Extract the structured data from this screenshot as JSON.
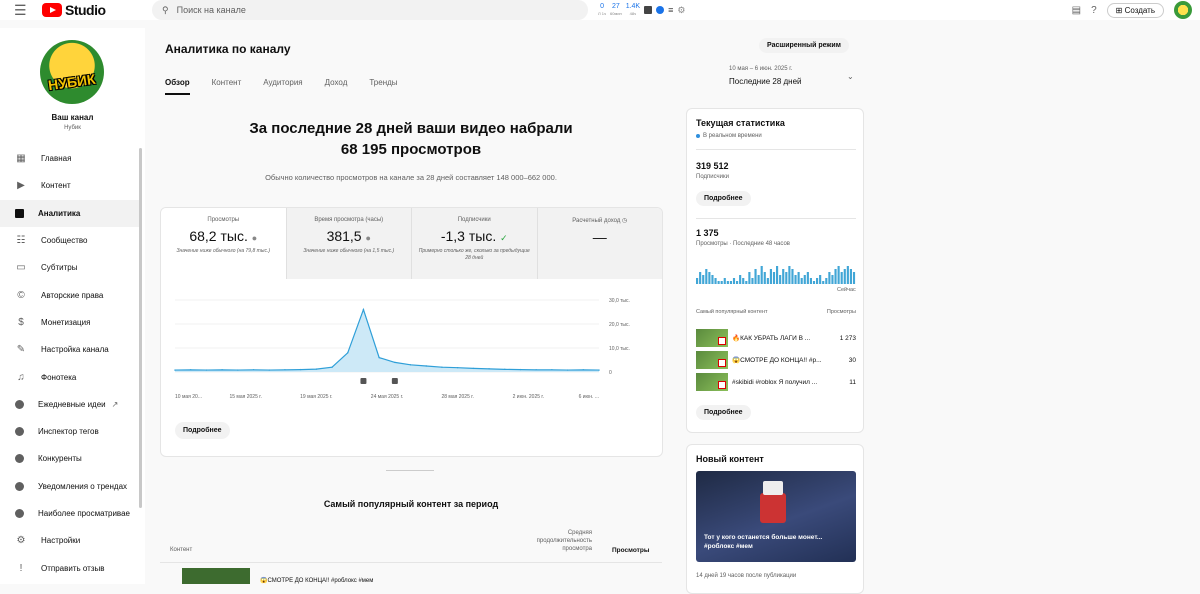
{
  "topbar": {
    "logo_text": "Studio",
    "search_placeholder": "Поиск на канале",
    "ext_stats": [
      {
        "value": "0",
        "sub": "Л 1ч"
      },
      {
        "value": "27",
        "sub": "60мин"
      },
      {
        "value": "1.4K",
        "sub": "48ч"
      }
    ],
    "create_label": "Создать"
  },
  "sidebar": {
    "your_channel": "Ваш канал",
    "channel_name": "Нубик",
    "avatar_text": "НУБИК",
    "items": [
      {
        "label": "Главная",
        "icon": "dashboard-icon"
      },
      {
        "label": "Контент",
        "icon": "content-icon"
      },
      {
        "label": "Аналитика",
        "icon": "analytics-icon"
      },
      {
        "label": "Сообщество",
        "icon": "community-icon"
      },
      {
        "label": "Субтитры",
        "icon": "subtitles-icon"
      },
      {
        "label": "Авторские права",
        "icon": "copyright-icon"
      },
      {
        "label": "Монетизация",
        "icon": "monetization-icon"
      },
      {
        "label": "Настройка канала",
        "icon": "customization-icon"
      },
      {
        "label": "Фонотека",
        "icon": "audio-library-icon"
      },
      {
        "label": "Ежедневные идеи",
        "icon": "ideas-icon"
      },
      {
        "label": "Инспектор тегов",
        "icon": "tags-icon"
      },
      {
        "label": "Конкуренты",
        "icon": "competitors-icon"
      },
      {
        "label": "Уведомления о трендах",
        "icon": "trends-icon"
      },
      {
        "label": "Наиболее просматривае",
        "icon": "most-viewed-icon"
      },
      {
        "label": "Настройки",
        "icon": "settings-icon"
      },
      {
        "label": "Отправить отзыв",
        "icon": "feedback-icon"
      }
    ]
  },
  "main": {
    "title": "Аналитика по каналу",
    "tabs": [
      "Обзор",
      "Контент",
      "Аудитория",
      "Доход",
      "Тренды"
    ],
    "advanced_label": "Расширенный режим",
    "date_range": "10 мая – 6 июн. 2025 г.",
    "date_label": "Последние 28 дней",
    "headline_line1": "За последние 28 дней ваши видео набрали",
    "headline_line2": "68 195 просмотров",
    "typical_text": "Обычно количество просмотров на канале за 28 дней составляет 148 000–662 000.",
    "metrics": [
      {
        "label": "Просмотры",
        "value": "68,2 тыс.",
        "note": "Значение ниже обычного (на 79,8 тыс.)"
      },
      {
        "label": "Время просмотра (часы)",
        "value": "381,5",
        "note": "Значение ниже обычного (на 1,5 тыс.)"
      },
      {
        "label": "Подписчики",
        "value": "-1,3 тыс.",
        "note": "Примерно столько же, сколько за предыдущие 28 дней"
      },
      {
        "label": "Расчетный доход",
        "value": "—",
        "note": ""
      }
    ],
    "more_label": "Подробнее",
    "top_content_title": "Самый популярный контент за период",
    "table": {
      "col_content": "Контент",
      "col_avg": "Средняя продолжительность просмотра",
      "col_views": "Просмотры"
    },
    "first_row_title": "😱СМОТРЕ ДО КОНЦА!! #роблокс #мем"
  },
  "chart_data": {
    "type": "line",
    "x": [
      "10 мая 2025 г.",
      "15 мая 2025 г.",
      "19 мая 2025 г.",
      "24 мая 2025 г.",
      "28 мая 2025 г.",
      "2 июн. 2025 г.",
      "6 июн. 2025 г."
    ],
    "x_labels": [
      "10 мая 20...",
      "15 мая 2025 г.",
      "19 мая 2025 г.",
      "24 мая 2025 г.",
      "28 мая 2025 г.",
      "2 июн. 2025 г.",
      "6 июн. ..."
    ],
    "values": [
      800,
      900,
      800,
      900,
      800,
      900,
      800,
      900,
      1000,
      1200,
      2000,
      8000,
      26000,
      6000,
      4000,
      3000,
      2500,
      2000,
      1800,
      1500,
      1300,
      1100,
      1000,
      900,
      900,
      800,
      900,
      800
    ],
    "y_ticks": [
      "0",
      "10,0 тыс.",
      "20,0 тыс.",
      "30,0 тыс."
    ],
    "ylim": [
      0,
      30000
    ],
    "series_color": "#2f9fd8",
    "fill_color": "#cde9f7"
  },
  "realtime": {
    "title": "Текущая статистика",
    "live": "В реальном времени",
    "subs_value": "319 512",
    "subs_label": "Подписчики",
    "more_label": "Подробнее",
    "views_value": "1 375",
    "views_label": "Просмотры · Последние 48 часов",
    "now_label": "Сейчас",
    "pop_head_left": "Самый популярный контент",
    "pop_head_right": "Просмотры",
    "top": [
      {
        "title": "🔥КАК УБРАТЬ ЛАГИ В ...",
        "views": "1 273"
      },
      {
        "title": "😱СМОТРЕ ДО КОНЦА!! #р...",
        "views": "30"
      },
      {
        "title": "#skibidi #roblox Я получил ...",
        "views": "11"
      }
    ],
    "bars": [
      2,
      4,
      3,
      5,
      4,
      3,
      2,
      1,
      1,
      2,
      1,
      1,
      2,
      1,
      3,
      2,
      1,
      4,
      2,
      5,
      3,
      6,
      4,
      2,
      5,
      4,
      6,
      3,
      5,
      4,
      6,
      5,
      3,
      4,
      2,
      3,
      4,
      2,
      1,
      2,
      3,
      1,
      2,
      4,
      3,
      5,
      6,
      4,
      5,
      6,
      5,
      4
    ]
  },
  "new_content": {
    "title": "Новый контент",
    "thumb_text": "Тот у кого останется больше монет...",
    "thumb_tag": "#роблокс #мем",
    "meta": "14 дней 19 часов после публикации"
  }
}
